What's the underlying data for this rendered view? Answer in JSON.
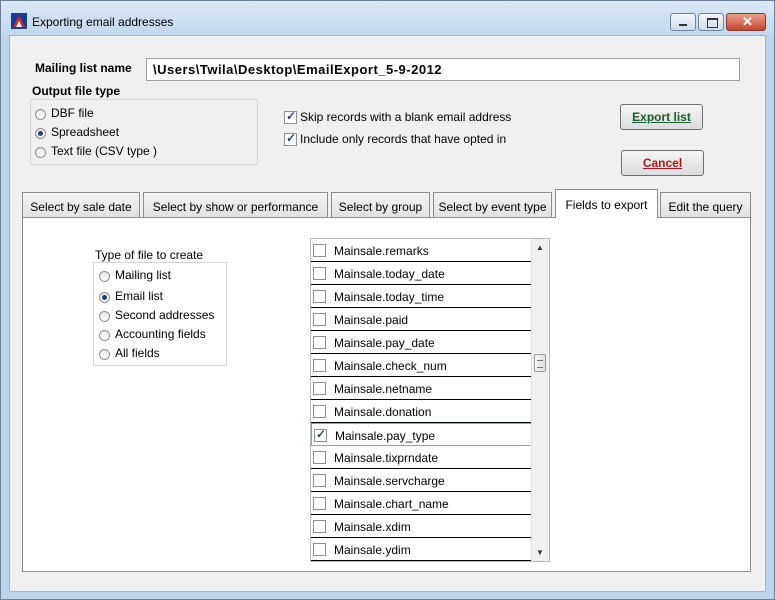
{
  "window": {
    "title": "Exporting email addresses"
  },
  "mailing": {
    "label": "Mailing list name",
    "path": "\\Users\\Twila\\Desktop\\EmailExport_5-9-2012"
  },
  "output": {
    "label": "Output file type",
    "options": [
      {
        "label": "DBF file",
        "selected": false
      },
      {
        "label": "Spreadsheet",
        "selected": true
      },
      {
        "label": "Text file (CSV type )",
        "selected": false
      }
    ]
  },
  "options": {
    "skip_blank": "Skip records with a blank email address",
    "opted_in": "Include only records that have opted in"
  },
  "buttons": {
    "export": "Export list",
    "cancel": "Cancel"
  },
  "tabs": [
    "Select by sale date",
    "Select by show or performance",
    "Select by group",
    "Select by event type",
    "Fields to export",
    "Edit the query"
  ],
  "filetype": {
    "label": "Type of file to create",
    "options": [
      {
        "label": "Mailing list",
        "selected": false
      },
      {
        "label": "Email list",
        "selected": true
      },
      {
        "label": "Second addresses",
        "selected": false
      },
      {
        "label": "Accounting fields",
        "selected": false
      },
      {
        "label": "All fields",
        "selected": false
      }
    ]
  },
  "fields": [
    {
      "name": "Mainsale.remarks",
      "checked": false
    },
    {
      "name": "Mainsale.today_date",
      "checked": false
    },
    {
      "name": "Mainsale.today_time",
      "checked": false
    },
    {
      "name": "Mainsale.paid",
      "checked": false
    },
    {
      "name": "Mainsale.pay_date",
      "checked": false
    },
    {
      "name": "Mainsale.check_num",
      "checked": false
    },
    {
      "name": "Mainsale.netname",
      "checked": false
    },
    {
      "name": "Mainsale.donation",
      "checked": false
    },
    {
      "name": "Mainsale.pay_type",
      "checked": true
    },
    {
      "name": "Mainsale.tixprndate",
      "checked": false
    },
    {
      "name": "Mainsale.servcharge",
      "checked": false
    },
    {
      "name": "Mainsale.chart_name",
      "checked": false
    },
    {
      "name": "Mainsale.xdim",
      "checked": false
    },
    {
      "name": "Mainsale.ydim",
      "checked": false
    }
  ]
}
